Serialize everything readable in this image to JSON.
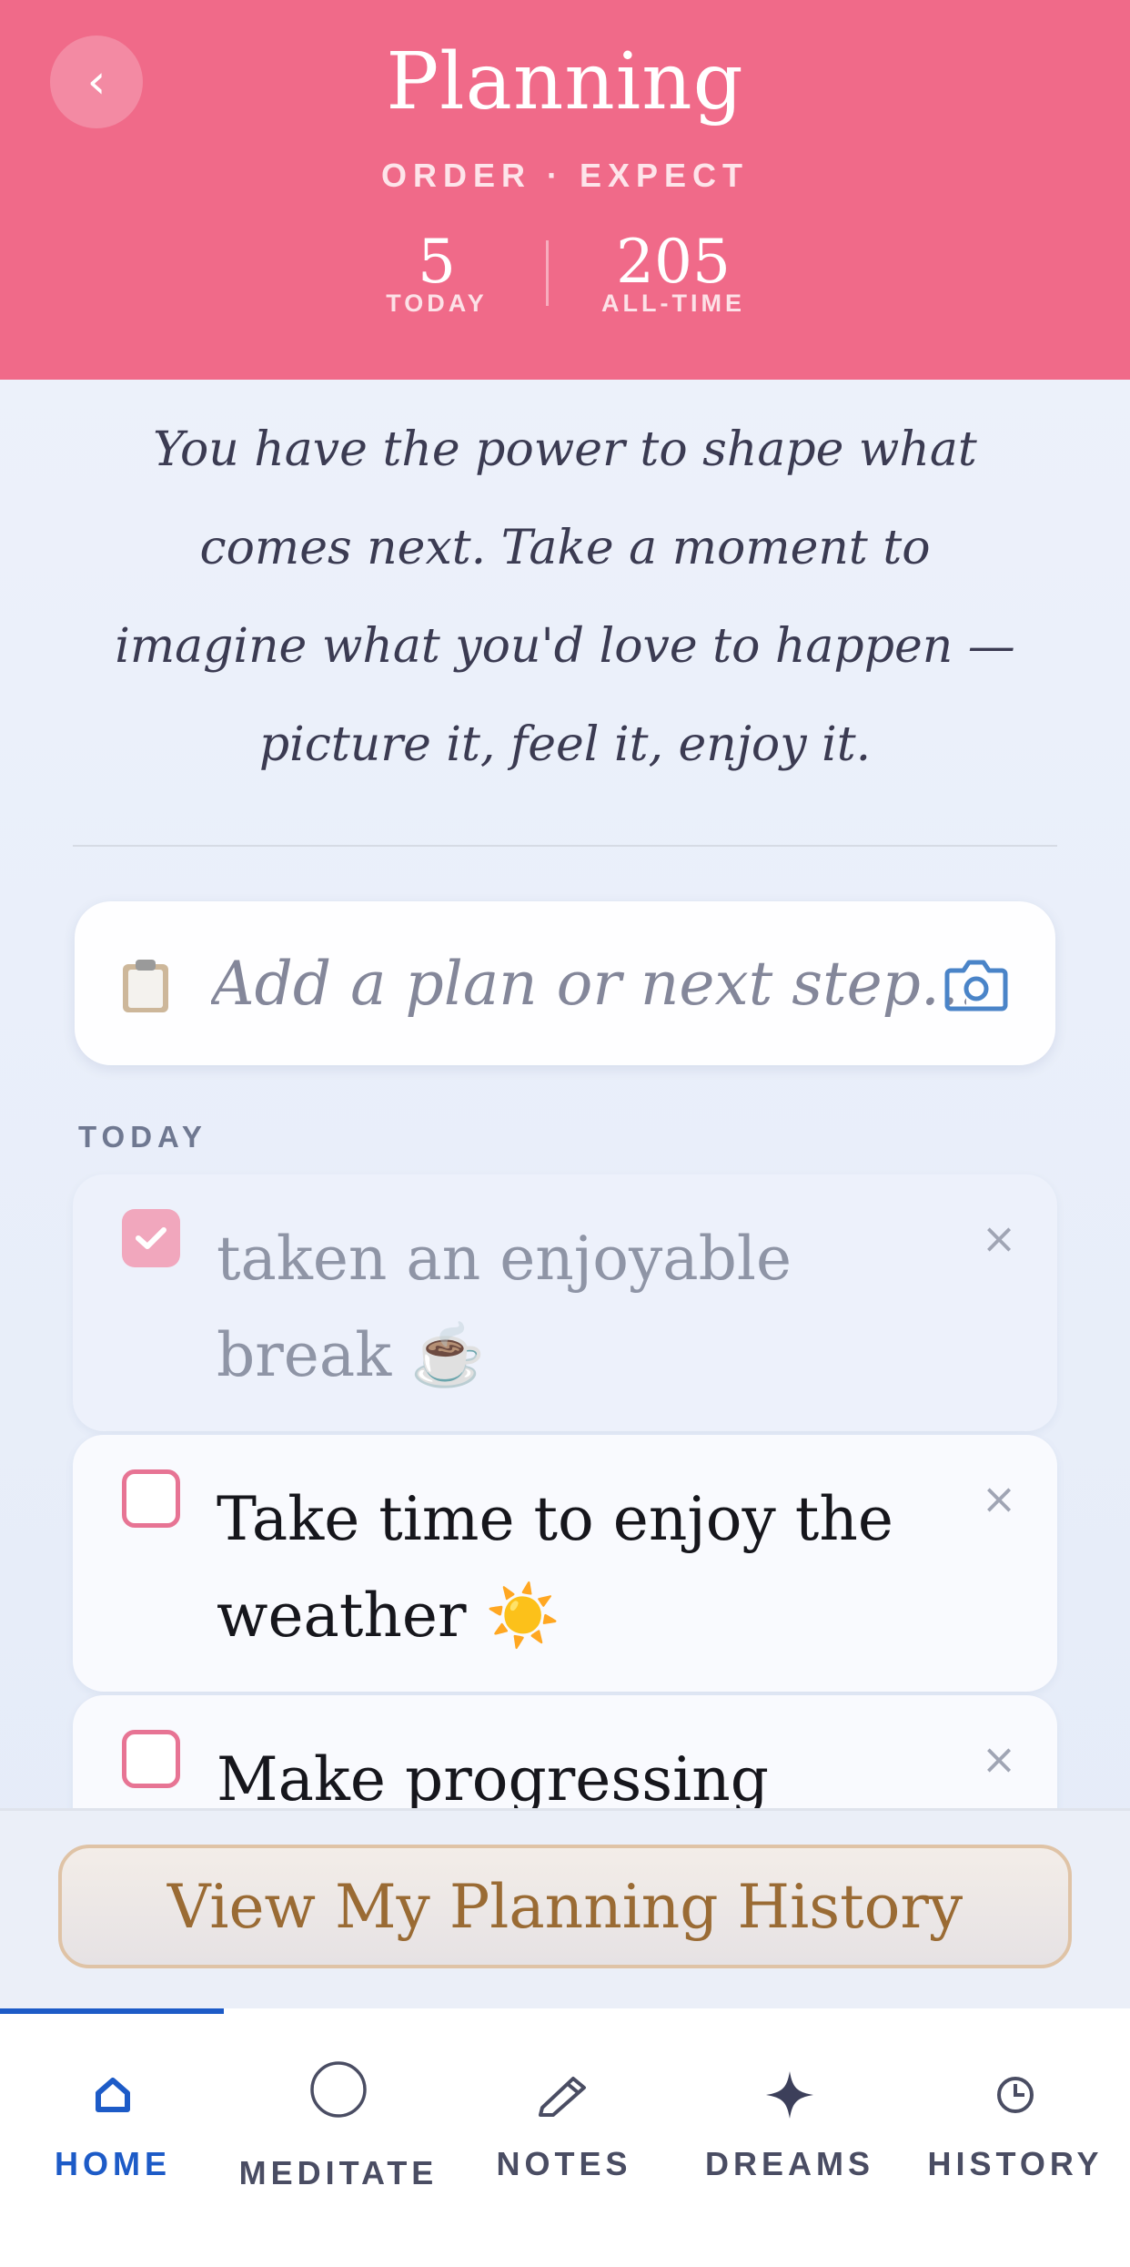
{
  "header": {
    "back_label": "‹",
    "title": "Planning",
    "subtitle": "ORDER · EXPECT",
    "stats": {
      "today_value": "5",
      "today_label": "TODAY",
      "alltime_value": "205",
      "alltime_label": "ALL-TIME"
    }
  },
  "quote": "You have the power to shape what comes next. Take a moment to imagine what you'd love to happen — picture it, feel it, enjoy it.",
  "composer": {
    "placeholder": "Add a plan or next step...",
    "icons": [
      "clipboard-icon",
      "camera-icon"
    ]
  },
  "section_label": "TODAY",
  "tasks": [
    {
      "text": "taken an enjoyable break ☕",
      "done": true
    },
    {
      "text": "Take time to enjoy the weather ☀️",
      "done": false
    },
    {
      "text": "Make progressing website",
      "done": false
    }
  ],
  "remove_glyph": "×",
  "history_button": "View My Planning History",
  "nav": {
    "items": [
      {
        "label": "HOME",
        "icon": "home-icon",
        "active": true
      },
      {
        "label": "MEDITATE",
        "icon": "circle-icon",
        "active": false
      },
      {
        "label": "NOTES",
        "icon": "pencil-icon",
        "active": false
      },
      {
        "label": "DREAMS",
        "icon": "sparkle-icon",
        "active": false
      },
      {
        "label": "HISTORY",
        "icon": "clock-icon",
        "active": false
      }
    ]
  },
  "colors": {
    "header": "#f06a89",
    "accent": "#1d5bc7",
    "checkbox": "#e77494",
    "history_text": "#9a6b34"
  }
}
